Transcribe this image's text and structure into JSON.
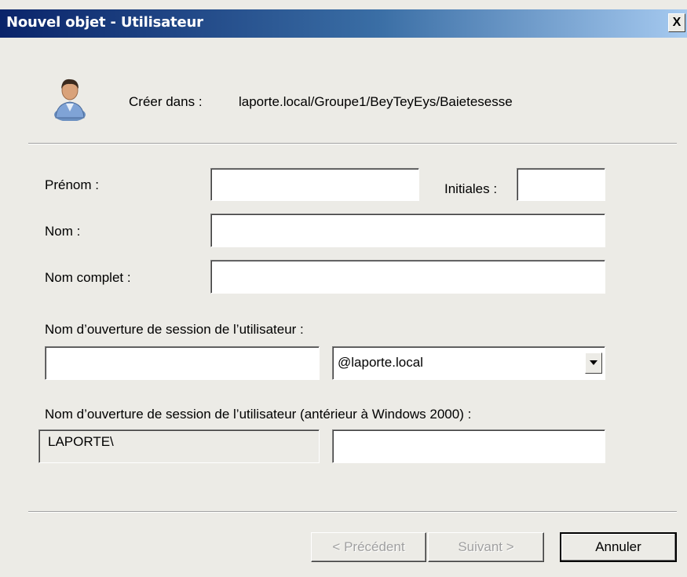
{
  "window": {
    "title": "Nouvel objet - Utilisateur",
    "close_glyph": "X"
  },
  "header": {
    "icon": "user-icon",
    "create_in_label": "Créer dans :",
    "create_in_path": "laporte.local/Groupe1/BeyTeyEys/Baietesesse"
  },
  "form": {
    "first_name": {
      "label": "Prénom :",
      "value": ""
    },
    "initials": {
      "label": "Initiales :",
      "value": ""
    },
    "last_name": {
      "label": "Nom :",
      "value": ""
    },
    "full_name": {
      "label": "Nom complet :",
      "value": ""
    },
    "logon_name": {
      "label": "Nom d’ouverture de session de l’utilisateur :",
      "value": "",
      "domain_selected": "@laporte.local"
    },
    "pre2000_logon": {
      "label": "Nom d’ouverture de session de l’utilisateur (antérieur à Windows 2000) :",
      "domain_prefix": "LAPORTE\\",
      "value": ""
    }
  },
  "buttons": {
    "previous": "< Précédent",
    "next": "Suivant >",
    "cancel": "Annuler"
  },
  "colors": {
    "titlebar_start": "#0a246a",
    "titlebar_end": "#a6caf0",
    "dialog_bg": "#ecebe6"
  }
}
